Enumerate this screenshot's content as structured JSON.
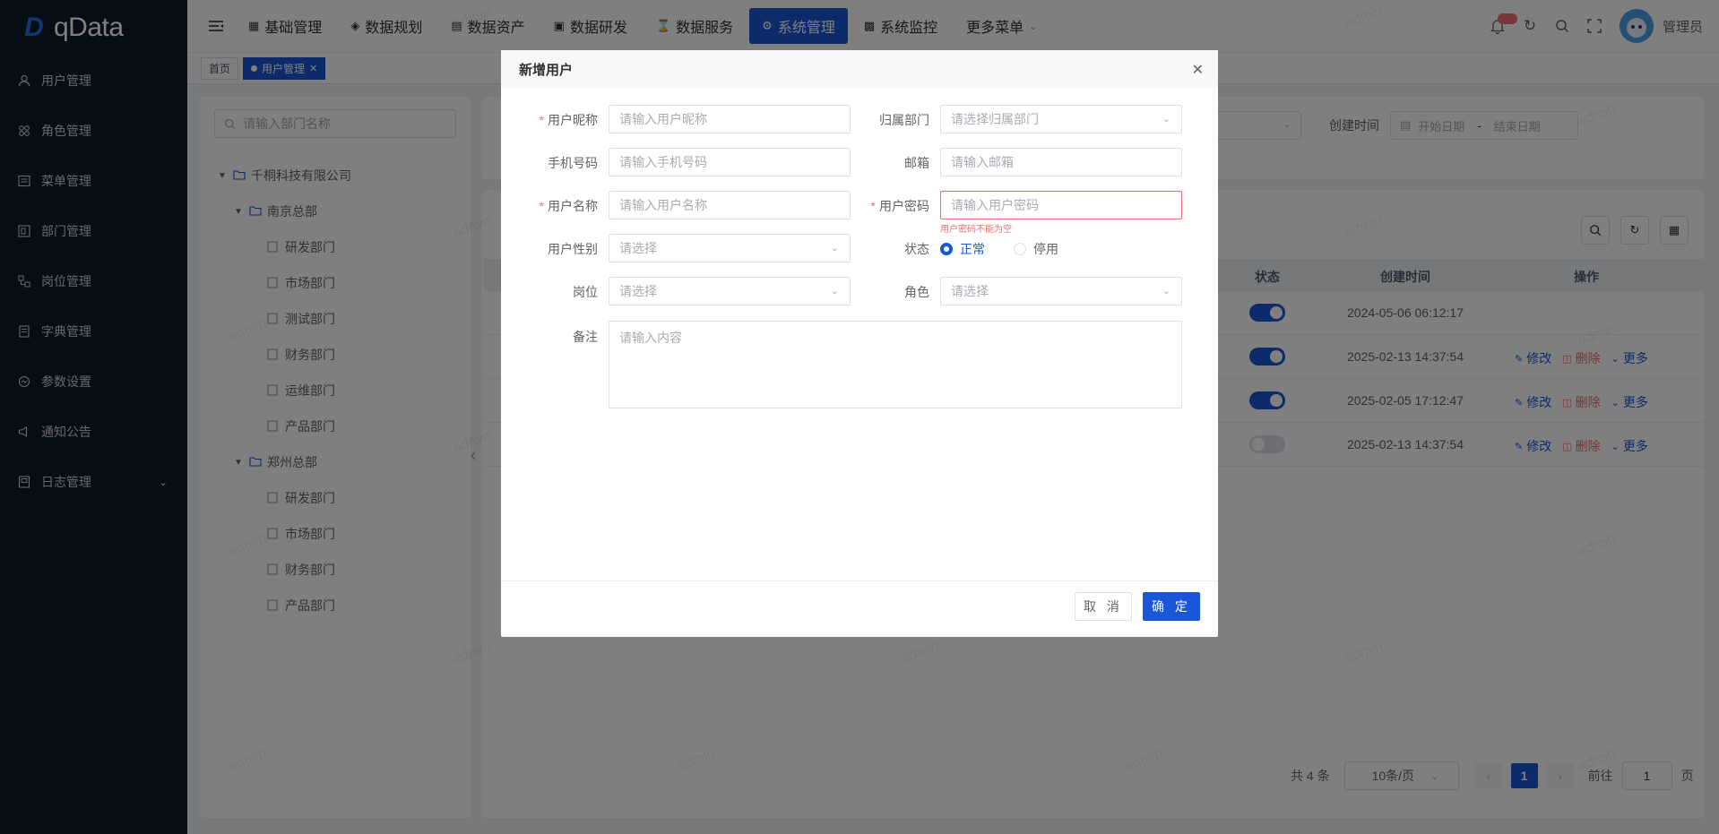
{
  "brand": {
    "name": "qData"
  },
  "sidebar": {
    "items": [
      {
        "label": "用户管理",
        "icon": "user-icon"
      },
      {
        "label": "角色管理",
        "icon": "role-icon"
      },
      {
        "label": "菜单管理",
        "icon": "menu-icon"
      },
      {
        "label": "部门管理",
        "icon": "dept-icon"
      },
      {
        "label": "岗位管理",
        "icon": "post-icon"
      },
      {
        "label": "字典管理",
        "icon": "dict-icon"
      },
      {
        "label": "参数设置",
        "icon": "params-icon"
      },
      {
        "label": "通知公告",
        "icon": "notice-icon"
      },
      {
        "label": "日志管理",
        "icon": "log-icon"
      }
    ]
  },
  "topnav": {
    "items": [
      {
        "label": "基础管理"
      },
      {
        "label": "数据规划"
      },
      {
        "label": "数据资产"
      },
      {
        "label": "数据研发"
      },
      {
        "label": "数据服务"
      },
      {
        "label": "系统管理"
      },
      {
        "label": "系统监控"
      },
      {
        "label": "更多菜单"
      }
    ],
    "active_index": 5,
    "user_name": "管理员"
  },
  "tags": {
    "home": "首页",
    "current": "用户管理"
  },
  "tree": {
    "search_placeholder": "请输入部门名称",
    "root": "千桐科技有限公司",
    "nanjing": "南京总部",
    "nanjing_children": [
      "研发部门",
      "市场部门",
      "测试部门",
      "财务部门",
      "运维部门",
      "产品部门"
    ],
    "zhengzhou": "郑州总部",
    "zhengzhou_children": [
      "研发部门",
      "市场部门",
      "财务部门",
      "产品部门"
    ]
  },
  "filter": {
    "create_time_label": "创建时间",
    "start_placeholder": "开始日期",
    "end_placeholder": "结束日期",
    "range_sep": "-"
  },
  "table": {
    "headers": {
      "status": "状态",
      "created": "创建时间",
      "actions": "操作"
    },
    "rows": [
      {
        "enabled": true,
        "created": "2024-05-06 06:12:17",
        "has_actions": false
      },
      {
        "enabled": true,
        "created": "2025-02-13 14:37:54",
        "has_actions": true
      },
      {
        "enabled": true,
        "created": "2025-02-05 17:12:47",
        "has_actions": true
      },
      {
        "enabled": false,
        "created": "2025-02-13 14:37:54",
        "has_actions": true
      }
    ],
    "action_labels": {
      "edit": "修改",
      "delete": "删除",
      "more": "更多"
    }
  },
  "pagination": {
    "total": "共 4 条",
    "page_size": "10条/页",
    "current_page": "1",
    "goto_label": "前往",
    "goto_value": "1",
    "page_suffix": "页"
  },
  "watermark": "admin",
  "dialog": {
    "title": "新增用户",
    "fields": {
      "nickname": {
        "label": "用户昵称",
        "placeholder": "请输入用户昵称",
        "required": true
      },
      "dept": {
        "label": "归属部门",
        "placeholder": "请选择归属部门"
      },
      "phone": {
        "label": "手机号码",
        "placeholder": "请输入手机号码"
      },
      "email": {
        "label": "邮箱",
        "placeholder": "请输入邮箱"
      },
      "username": {
        "label": "用户名称",
        "placeholder": "请输入用户名称",
        "required": true
      },
      "password": {
        "label": "用户密码",
        "placeholder": "请输入用户密码",
        "required": true,
        "error": "用户密码不能为空"
      },
      "gender": {
        "label": "用户性别",
        "placeholder": "请选择"
      },
      "status": {
        "label": "状态",
        "options": [
          "正常",
          "停用"
        ],
        "selected": "正常"
      },
      "post": {
        "label": "岗位",
        "placeholder": "请选择"
      },
      "role": {
        "label": "角色",
        "placeholder": "请选择"
      },
      "remark": {
        "label": "备注",
        "placeholder": "请输入内容"
      }
    },
    "buttons": {
      "cancel": "取 消",
      "ok": "确 定"
    }
  },
  "colors": {
    "primary": "#1a57d6",
    "sidebar_bg": "#0f1a2a",
    "error": "#f56c6c"
  }
}
